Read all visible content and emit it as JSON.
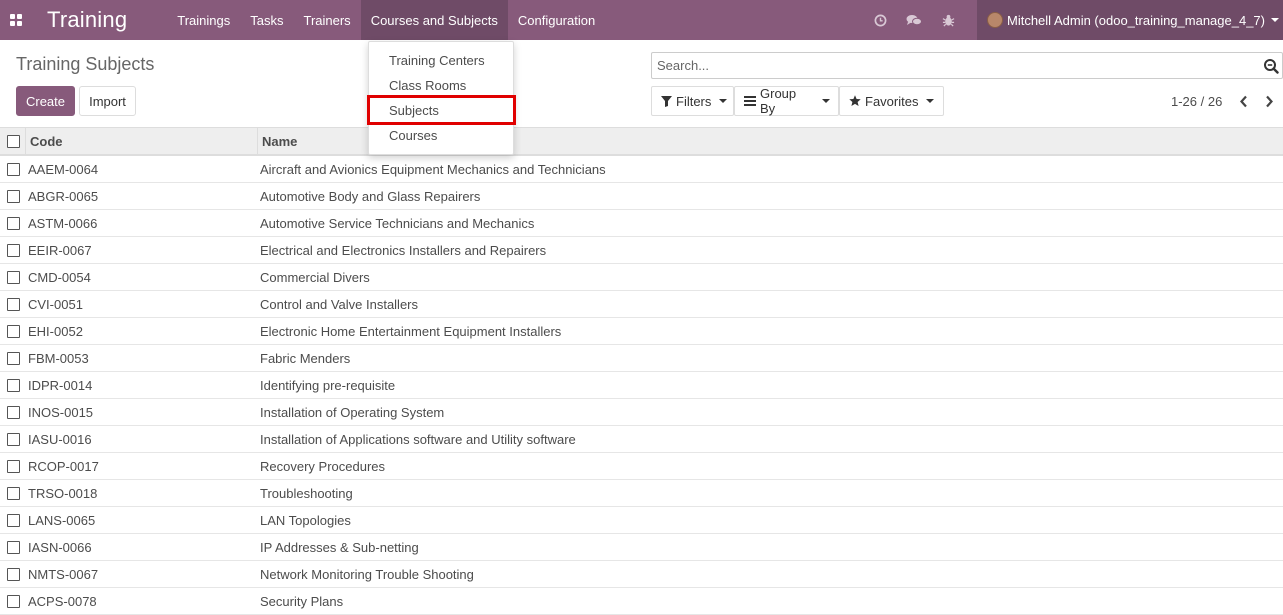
{
  "navbar": {
    "brand": "Training",
    "menu": [
      "Trainings",
      "Tasks",
      "Trainers",
      "Courses and Subjects",
      "Configuration"
    ],
    "user": "Mitchell Admin (odoo_training_manage_4_7)",
    "icons": [
      "apps-icon",
      "clock-icon",
      "chat-icon",
      "bug-icon"
    ]
  },
  "dropdown": {
    "items": [
      "Training Centers",
      "Class Rooms",
      "Subjects",
      "Courses"
    ]
  },
  "control": {
    "title": "Training Subjects",
    "create": "Create",
    "import": "Import",
    "search_placeholder": "Search...",
    "filters": "Filters",
    "group_by": "Group By",
    "favorites": "Favorites",
    "pager": "1-26 / 26"
  },
  "table": {
    "headers": [
      "Code",
      "Name"
    ],
    "rows": [
      [
        "AAEM-0064",
        "Aircraft and Avionics Equipment Mechanics and Technicians"
      ],
      [
        "ABGR-0065",
        "Automotive Body and Glass Repairers"
      ],
      [
        "ASTM-0066",
        "Automotive Service Technicians and Mechanics"
      ],
      [
        "EEIR-0067",
        "Electrical and Electronics Installers and Repairers"
      ],
      [
        "CMD-0054",
        "Commercial Divers"
      ],
      [
        "CVI-0051",
        "Control and Valve Installers"
      ],
      [
        "EHI-0052",
        "Electronic Home Entertainment Equipment Installers"
      ],
      [
        "FBM-0053",
        "Fabric Menders"
      ],
      [
        "IDPR-0014",
        "Identifying pre-requisite"
      ],
      [
        "INOS-0015",
        "Installation of Operating System"
      ],
      [
        "IASU-0016",
        "Installation of Applications software and Utility software"
      ],
      [
        "RCOP-0017",
        "Recovery Procedures"
      ],
      [
        "TRSO-0018",
        "Troubleshooting"
      ],
      [
        "LANS-0065",
        "LAN Topologies"
      ],
      [
        "IASN-0066",
        "IP Addresses & Sub-netting"
      ],
      [
        "NMTS-0067",
        "Network Monitoring Trouble Shooting"
      ],
      [
        "ACPS-0078",
        "Security Plans"
      ]
    ]
  },
  "colors": {
    "navbar": "#875a7b",
    "navbar_active": "#6f4b67",
    "highlight": "#e00000"
  }
}
